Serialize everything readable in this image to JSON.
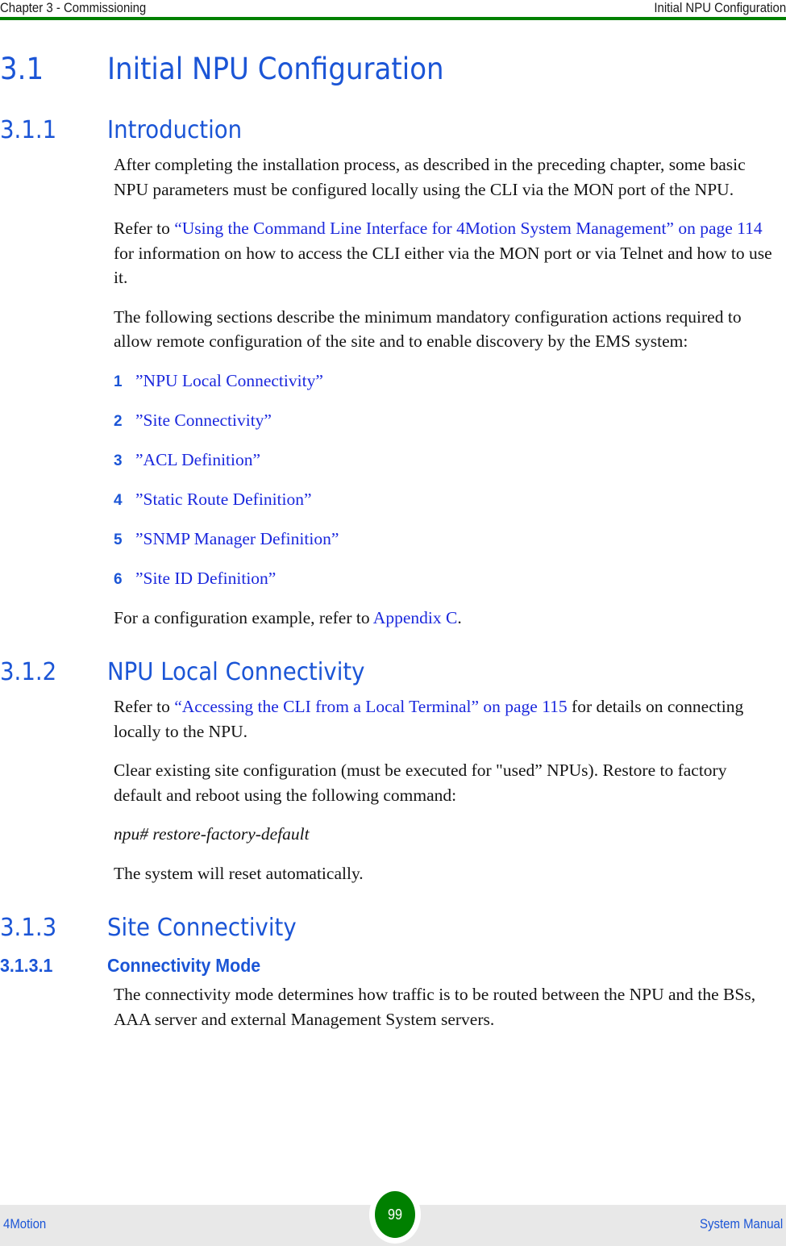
{
  "header": {
    "left": "Chapter 3 - Commissioning",
    "right": "Initial NPU Configuration",
    "rule_color": "#008000"
  },
  "footer": {
    "left": "4Motion",
    "right": "System Manual",
    "page_number": "99",
    "badge_color": "#008000",
    "band_color": "#e8e8e8",
    "text_color": "#1b55d6"
  },
  "colors": {
    "heading": "#1b55d6",
    "link": "#1b28dd",
    "body": "#141414"
  },
  "sections": {
    "s31": {
      "number": "3.1",
      "title": "Initial NPU Configuration"
    },
    "s311": {
      "number": "3.1.1",
      "title": "Introduction",
      "para1": "After completing the installation process, as described in the preceding chapter, some basic NPU parameters must be configured locally using the CLI via the MON port of the NPU.",
      "para2_pre": "Refer to ",
      "para2_link": "“Using the Command Line Interface for 4Motion System Management” on page 114",
      "para2_post": " for information on how to access the CLI either via the MON port or via Telnet and how to use it.",
      "para3": "The following sections describe the minimum mandatory configuration actions required to allow remote configuration of the site and to enable discovery by the EMS system:",
      "list": [
        {
          "num": "1",
          "label": "”NPU Local Connectivity”"
        },
        {
          "num": "2",
          "label": "”Site Connectivity”"
        },
        {
          "num": "3",
          "label": "”ACL Definition”"
        },
        {
          "num": "4",
          "label": "”Static Route Definition”"
        },
        {
          "num": "5",
          "label": "”SNMP Manager Definition”"
        },
        {
          "num": "6",
          "label": "”Site ID Definition”"
        }
      ],
      "para4_pre": "For a configuration example, refer to ",
      "para4_link": "Appendix C",
      "para4_post": "."
    },
    "s312": {
      "number": "3.1.2",
      "title": "NPU Local Connectivity",
      "para1_pre": "Refer to ",
      "para1_link": "“Accessing the CLI from a Local Terminal” on page 115",
      "para1_post": " for details on connecting locally to the NPU.",
      "para2": "Clear existing site configuration (must be executed for \"used” NPUs). Restore to factory default and reboot using the following command:",
      "command": "npu# restore-factory-default",
      "para3": "The system will reset automatically."
    },
    "s313": {
      "number": "3.1.3",
      "title": "Site Connectivity"
    },
    "s3131": {
      "number": "3.1.3.1",
      "title": "Connectivity Mode",
      "para1": "The connectivity mode determines how traffic is to be routed between the NPU and the BSs, AAA server and external Management System servers."
    }
  }
}
